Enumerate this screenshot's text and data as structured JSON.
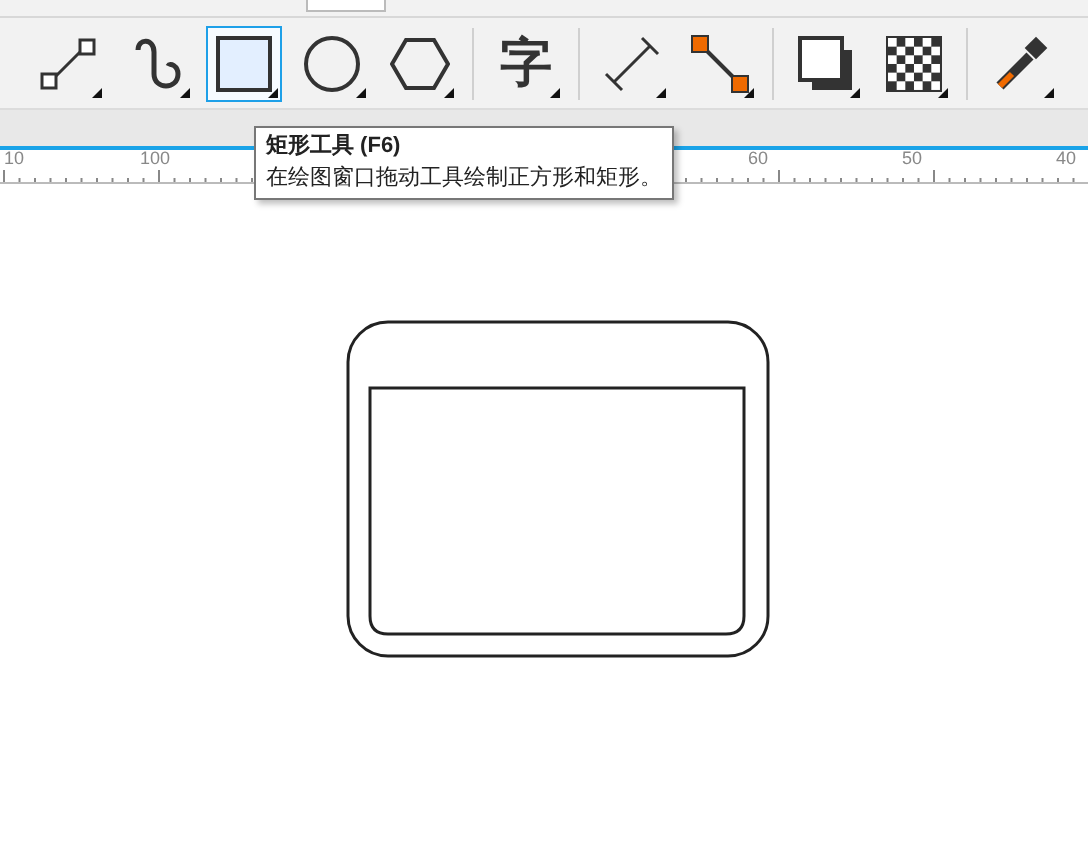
{
  "toolbar": {
    "tools": [
      {
        "kind": "line",
        "selected": false
      },
      {
        "kind": "spiral",
        "selected": false
      },
      {
        "kind": "rectangle",
        "selected": true
      },
      {
        "kind": "ellipse",
        "selected": false
      },
      {
        "kind": "polygon",
        "selected": false
      },
      {
        "kind": "text",
        "selected": false,
        "glyph": "字"
      },
      {
        "kind": "dimension",
        "selected": false
      },
      {
        "kind": "connector",
        "selected": false
      },
      {
        "kind": "shadow",
        "selected": false
      },
      {
        "kind": "transparency",
        "selected": false
      },
      {
        "kind": "eyedropper",
        "selected": false
      }
    ]
  },
  "tooltip": {
    "title": "矩形工具 (F6)",
    "description": "在绘图窗口拖动工具绘制正方形和矩形。"
  },
  "ruler": {
    "labels": [
      "10",
      "100",
      "60",
      "50",
      "40"
    ]
  }
}
